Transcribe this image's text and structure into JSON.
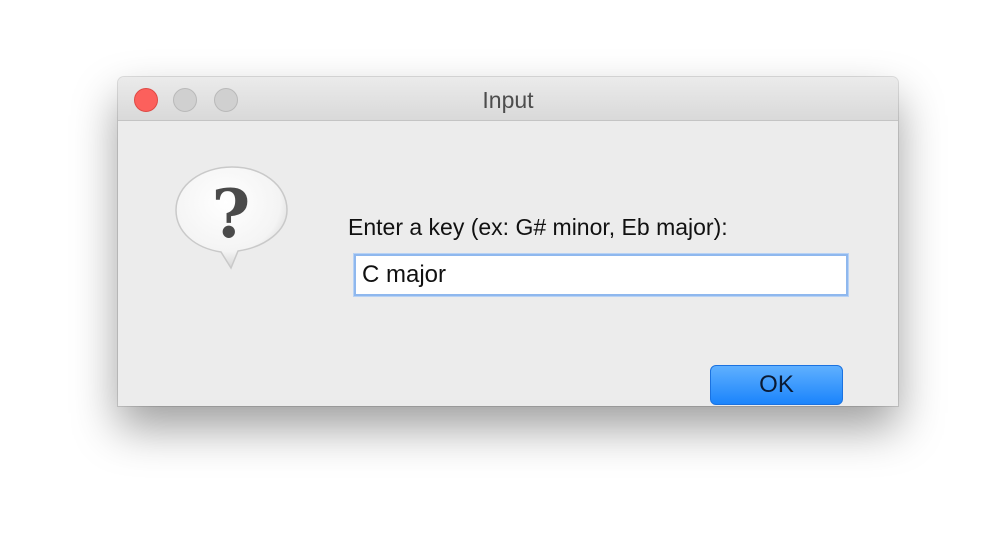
{
  "window": {
    "title": "Input",
    "controls": {
      "close_color": "#fc605c",
      "minimize_color": "#d0d0d0",
      "maximize_color": "#d0d0d0"
    }
  },
  "dialog": {
    "icon": "question-icon",
    "prompt": "Enter a key (ex: G# minor, Eb major):",
    "input_value": "C major",
    "ok_label": "OK"
  },
  "colors": {
    "accent": "#1b84fb",
    "background": "#ececec"
  }
}
